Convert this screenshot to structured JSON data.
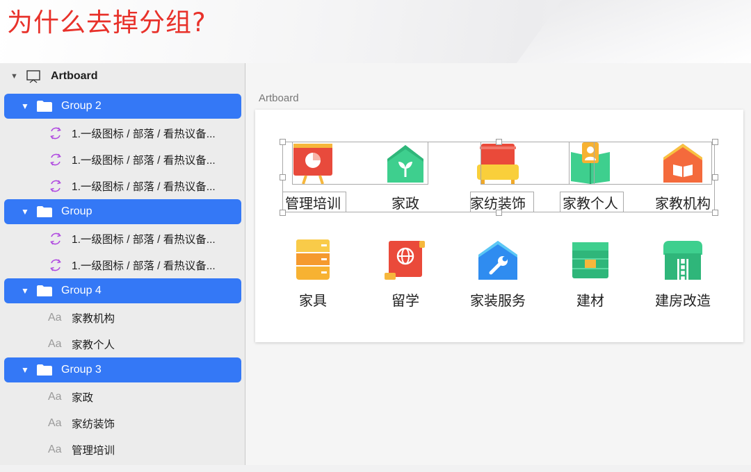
{
  "slide": {
    "title": "为什么去掉分组?"
  },
  "layers": {
    "artboard_label": "Artboard",
    "rows": [
      {
        "kind": "group",
        "label": "Group 2"
      },
      {
        "kind": "symbol",
        "label": "1.一级图标 / 部落 / 看热议备..."
      },
      {
        "kind": "symbol",
        "label": "1.一级图标 / 部落 / 看热议备..."
      },
      {
        "kind": "symbol",
        "label": "1.一级图标 / 部落 / 看热议备..."
      },
      {
        "kind": "group",
        "label": "Group"
      },
      {
        "kind": "symbol",
        "label": "1.一级图标 / 部落 / 看热议备..."
      },
      {
        "kind": "symbol",
        "label": "1.一级图标 / 部落 / 看热议备..."
      },
      {
        "kind": "group",
        "label": "Group 4"
      },
      {
        "kind": "text",
        "label": "家教机构"
      },
      {
        "kind": "text",
        "label": "家教个人"
      },
      {
        "kind": "group",
        "label": "Group 3"
      },
      {
        "kind": "text",
        "label": "家政"
      },
      {
        "kind": "text",
        "label": "家纺装饰"
      },
      {
        "kind": "text",
        "label": "管理培训"
      }
    ],
    "text_layer_glyph": "Aa"
  },
  "canvas": {
    "artboard_title": "Artboard",
    "icons": [
      {
        "label": "管理培训",
        "icon": "presentation-board-icon"
      },
      {
        "label": "家政",
        "icon": "house-sprout-icon"
      },
      {
        "label": "家纺装饰",
        "icon": "sofa-icon"
      },
      {
        "label": "家教个人",
        "icon": "tutor-book-icon"
      },
      {
        "label": "家教机构",
        "icon": "school-book-icon"
      },
      {
        "label": "家具",
        "icon": "cabinet-icon"
      },
      {
        "label": "留学",
        "icon": "globe-scroll-icon"
      },
      {
        "label": "家装服务",
        "icon": "wrench-house-icon"
      },
      {
        "label": "建材",
        "icon": "building-material-icon"
      },
      {
        "label": "建房改造",
        "icon": "house-ladder-icon"
      }
    ]
  },
  "colors": {
    "title_red": "#e8312a",
    "selection_blue": "#3478f6",
    "symbol_purple": "#b04ae0"
  }
}
